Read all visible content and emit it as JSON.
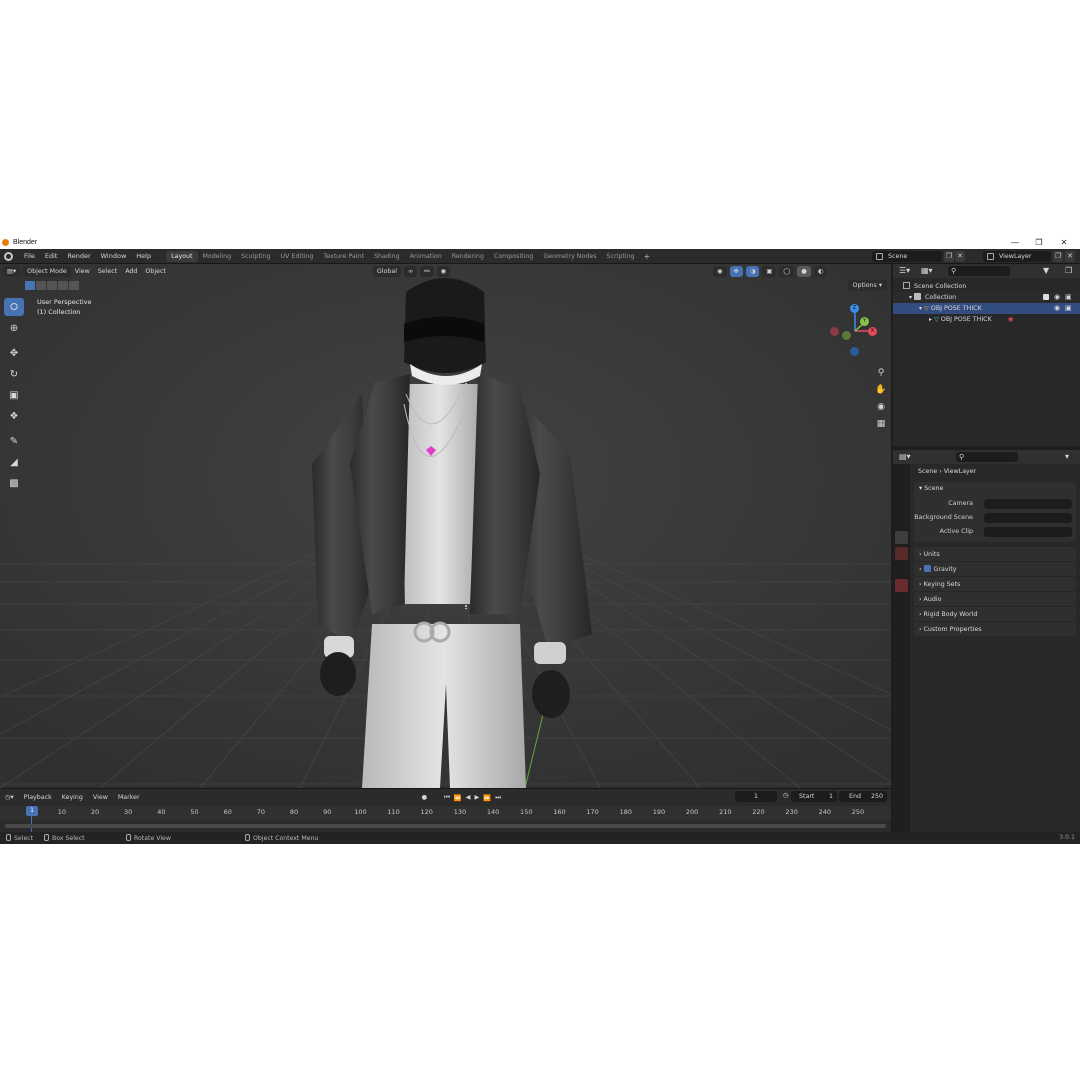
{
  "window": {
    "title": "Blender"
  },
  "menu": [
    "File",
    "Edit",
    "Render",
    "Window",
    "Help"
  ],
  "workspaces": [
    "Layout",
    "Modeling",
    "Sculpting",
    "UV Editing",
    "Texture Paint",
    "Shading",
    "Animation",
    "Rendering",
    "Compositing",
    "Geometry Nodes",
    "Scripting"
  ],
  "active_workspace": "Layout",
  "scene": {
    "name": "Scene",
    "view_layer": "ViewLayer"
  },
  "viewport": {
    "mode": "Object Mode",
    "menus": [
      "View",
      "Select",
      "Add",
      "Object"
    ],
    "transform_orientation": "Global",
    "view_name": "User Perspective",
    "collection_info": "(1) Collection",
    "options_label": "Options"
  },
  "gizmo": {
    "z": "Z",
    "y": "Y",
    "x": "X"
  },
  "timeline": {
    "menus": [
      "Playback",
      "Keying",
      "View",
      "Marker"
    ],
    "current_frame": "1",
    "start_label": "Start",
    "start": "1",
    "end_label": "End",
    "end": "250",
    "ruler": [
      "1",
      "10",
      "20",
      "30",
      "40",
      "50",
      "60",
      "70",
      "80",
      "90",
      "100",
      "110",
      "120",
      "130",
      "140",
      "150",
      "160",
      "170",
      "180",
      "190",
      "200",
      "210",
      "220",
      "230",
      "240",
      "250"
    ]
  },
  "status": {
    "select": "Select",
    "box_select": "Box Select",
    "rotate": "Rotate View",
    "context_menu": "Object Context Menu",
    "version": "3.0.1"
  },
  "outliner": {
    "root": "Scene Collection",
    "collection": "Collection",
    "object": "OBJ POSE THICK",
    "mesh": "OBJ POSE THICK"
  },
  "properties": {
    "breadcrumb_scene": "Scene",
    "breadcrumb_layer": "ViewLayer",
    "panel_scene": "Scene",
    "camera_label": "Camera",
    "background_label": "Background Scene",
    "active_clip_label": "Active Clip",
    "subpanels": [
      "Units",
      "Gravity",
      "Keying Sets",
      "Audio",
      "Rigid Body World",
      "Custom Properties"
    ]
  },
  "colors": {
    "accent": "#4772b3",
    "bg": "#1d1d1d",
    "viewport": "#393939",
    "x_axis": "#e44b5c",
    "y_axis": "#8bc34a",
    "z_axis": "#3b8ee6"
  }
}
